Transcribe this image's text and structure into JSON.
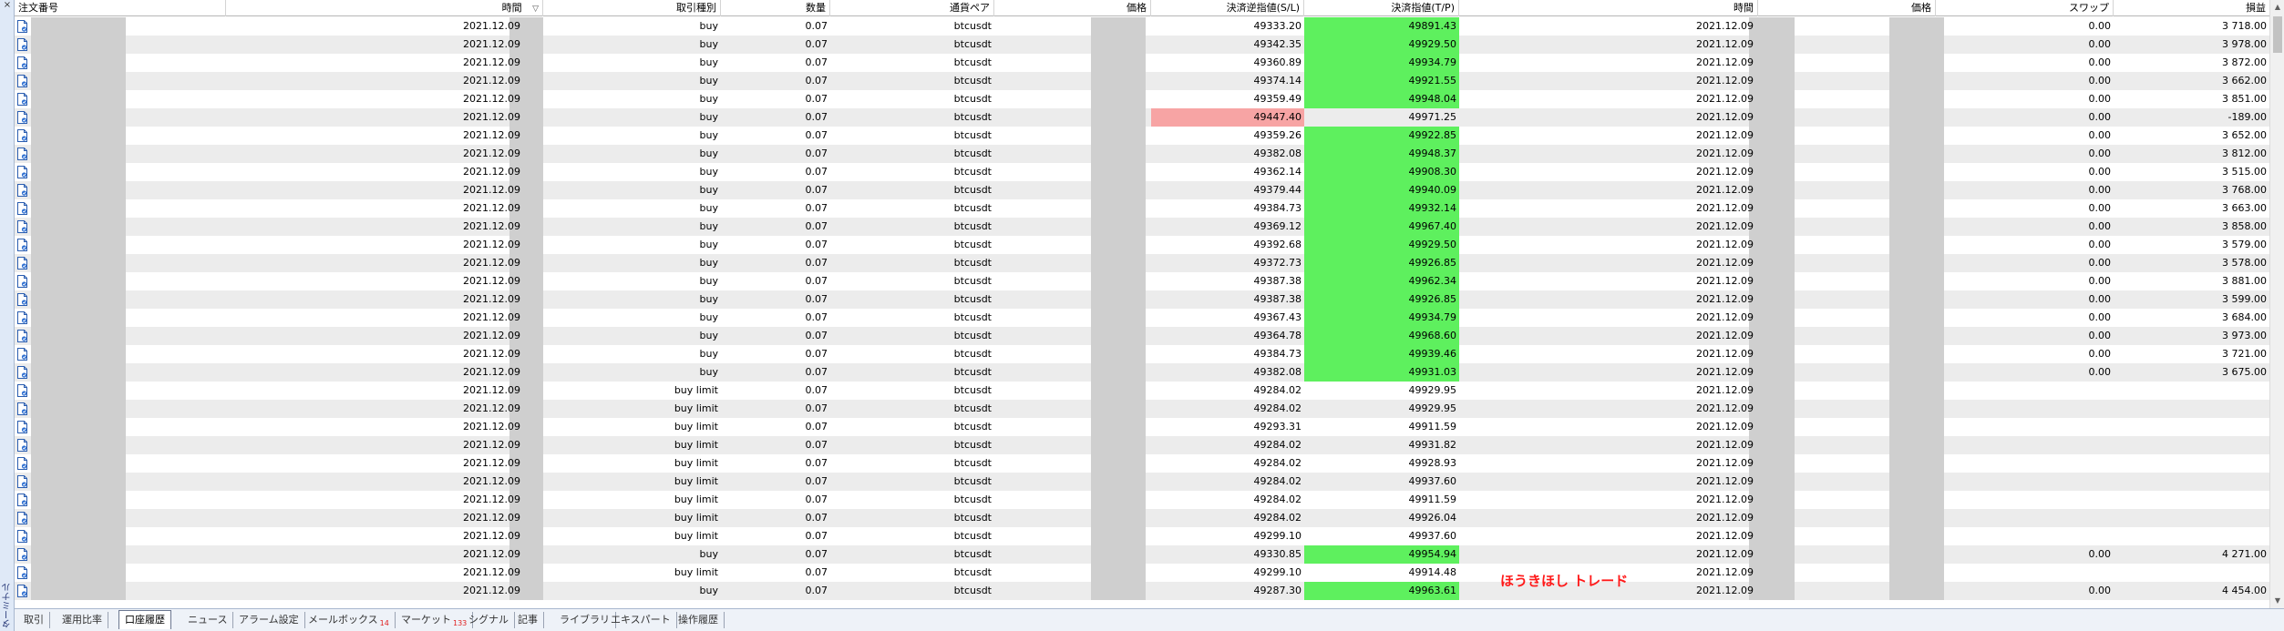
{
  "window": {
    "close_glyph": "×",
    "side_title": "ターミナル"
  },
  "columns": [
    "注文番号",
    "時間",
    "取引種別",
    "数量",
    "通貨ペア",
    "価格",
    "決済逆指値(S/L)",
    "決済指値(T/P)",
    "時間",
    "価格",
    "スワップ",
    "損益"
  ],
  "sort_indicator": "▽",
  "rows": [
    {
      "time": "2021.12.09",
      "type": "buy",
      "qty": "0.07",
      "pair": "btcusdt",
      "sl": "49333.20",
      "tp": "49891.43",
      "close_time": "2021.12.09",
      "swap": "0.00",
      "profit": "3 718.00",
      "sl_hit": false,
      "tp_hit": true
    },
    {
      "time": "2021.12.09",
      "type": "buy",
      "qty": "0.07",
      "pair": "btcusdt",
      "sl": "49342.35",
      "tp": "49929.50",
      "close_time": "2021.12.09",
      "swap": "0.00",
      "profit": "3 978.00",
      "sl_hit": false,
      "tp_hit": true
    },
    {
      "time": "2021.12.09",
      "type": "buy",
      "qty": "0.07",
      "pair": "btcusdt",
      "sl": "49360.89",
      "tp": "49934.79",
      "close_time": "2021.12.09",
      "swap": "0.00",
      "profit": "3 872.00",
      "sl_hit": false,
      "tp_hit": true
    },
    {
      "time": "2021.12.09",
      "type": "buy",
      "qty": "0.07",
      "pair": "btcusdt",
      "sl": "49374.14",
      "tp": "49921.55",
      "close_time": "2021.12.09",
      "swap": "0.00",
      "profit": "3 662.00",
      "sl_hit": false,
      "tp_hit": true
    },
    {
      "time": "2021.12.09",
      "type": "buy",
      "qty": "0.07",
      "pair": "btcusdt",
      "sl": "49359.49",
      "tp": "49948.04",
      "close_time": "2021.12.09",
      "swap": "0.00",
      "profit": "3 851.00",
      "sl_hit": false,
      "tp_hit": true
    },
    {
      "time": "2021.12.09",
      "type": "buy",
      "qty": "0.07",
      "pair": "btcusdt",
      "sl": "49447.40",
      "tp": "49971.25",
      "close_time": "2021.12.09",
      "swap": "0.00",
      "profit": "-189.00",
      "sl_hit": true,
      "tp_hit": false
    },
    {
      "time": "2021.12.09",
      "type": "buy",
      "qty": "0.07",
      "pair": "btcusdt",
      "sl": "49359.26",
      "tp": "49922.85",
      "close_time": "2021.12.09",
      "swap": "0.00",
      "profit": "3 652.00",
      "sl_hit": false,
      "tp_hit": true
    },
    {
      "time": "2021.12.09",
      "type": "buy",
      "qty": "0.07",
      "pair": "btcusdt",
      "sl": "49382.08",
      "tp": "49948.37",
      "close_time": "2021.12.09",
      "swap": "0.00",
      "profit": "3 812.00",
      "sl_hit": false,
      "tp_hit": true
    },
    {
      "time": "2021.12.09",
      "type": "buy",
      "qty": "0.07",
      "pair": "btcusdt",
      "sl": "49362.14",
      "tp": "49908.30",
      "close_time": "2021.12.09",
      "swap": "0.00",
      "profit": "3 515.00",
      "sl_hit": false,
      "tp_hit": true
    },
    {
      "time": "2021.12.09",
      "type": "buy",
      "qty": "0.07",
      "pair": "btcusdt",
      "sl": "49379.44",
      "tp": "49940.09",
      "close_time": "2021.12.09",
      "swap": "0.00",
      "profit": "3 768.00",
      "sl_hit": false,
      "tp_hit": true
    },
    {
      "time": "2021.12.09",
      "type": "buy",
      "qty": "0.07",
      "pair": "btcusdt",
      "sl": "49384.73",
      "tp": "49932.14",
      "close_time": "2021.12.09",
      "swap": "0.00",
      "profit": "3 663.00",
      "sl_hit": false,
      "tp_hit": true
    },
    {
      "time": "2021.12.09",
      "type": "buy",
      "qty": "0.07",
      "pair": "btcusdt",
      "sl": "49369.12",
      "tp": "49967.40",
      "close_time": "2021.12.09",
      "swap": "0.00",
      "profit": "3 858.00",
      "sl_hit": false,
      "tp_hit": true
    },
    {
      "time": "2021.12.09",
      "type": "buy",
      "qty": "0.07",
      "pair": "btcusdt",
      "sl": "49392.68",
      "tp": "49929.50",
      "close_time": "2021.12.09",
      "swap": "0.00",
      "profit": "3 579.00",
      "sl_hit": false,
      "tp_hit": true
    },
    {
      "time": "2021.12.09",
      "type": "buy",
      "qty": "0.07",
      "pair": "btcusdt",
      "sl": "49372.73",
      "tp": "49926.85",
      "close_time": "2021.12.09",
      "swap": "0.00",
      "profit": "3 578.00",
      "sl_hit": false,
      "tp_hit": true
    },
    {
      "time": "2021.12.09",
      "type": "buy",
      "qty": "0.07",
      "pair": "btcusdt",
      "sl": "49387.38",
      "tp": "49962.34",
      "close_time": "2021.12.09",
      "swap": "0.00",
      "profit": "3 881.00",
      "sl_hit": false,
      "tp_hit": true
    },
    {
      "time": "2021.12.09",
      "type": "buy",
      "qty": "0.07",
      "pair": "btcusdt",
      "sl": "49387.38",
      "tp": "49926.85",
      "close_time": "2021.12.09",
      "swap": "0.00",
      "profit": "3 599.00",
      "sl_hit": false,
      "tp_hit": true
    },
    {
      "time": "2021.12.09",
      "type": "buy",
      "qty": "0.07",
      "pair": "btcusdt",
      "sl": "49367.43",
      "tp": "49934.79",
      "close_time": "2021.12.09",
      "swap": "0.00",
      "profit": "3 684.00",
      "sl_hit": false,
      "tp_hit": true
    },
    {
      "time": "2021.12.09",
      "type": "buy",
      "qty": "0.07",
      "pair": "btcusdt",
      "sl": "49364.78",
      "tp": "49968.60",
      "close_time": "2021.12.09",
      "swap": "0.00",
      "profit": "3 973.00",
      "sl_hit": false,
      "tp_hit": true
    },
    {
      "time": "2021.12.09",
      "type": "buy",
      "qty": "0.07",
      "pair": "btcusdt",
      "sl": "49384.73",
      "tp": "49939.46",
      "close_time": "2021.12.09",
      "swap": "0.00",
      "profit": "3 721.00",
      "sl_hit": false,
      "tp_hit": true
    },
    {
      "time": "2021.12.09",
      "type": "buy",
      "qty": "0.07",
      "pair": "btcusdt",
      "sl": "49382.08",
      "tp": "49931.03",
      "close_time": "2021.12.09",
      "swap": "0.00",
      "profit": "3 675.00",
      "sl_hit": false,
      "tp_hit": true
    },
    {
      "time": "2021.12.09",
      "type": "buy limit",
      "qty": "0.07",
      "pair": "btcusdt",
      "sl": "49284.02",
      "tp": "49929.95",
      "close_time": "2021.12.09",
      "swap": "",
      "profit": "",
      "sl_hit": false,
      "tp_hit": false
    },
    {
      "time": "2021.12.09",
      "type": "buy limit",
      "qty": "0.07",
      "pair": "btcusdt",
      "sl": "49284.02",
      "tp": "49929.95",
      "close_time": "2021.12.09",
      "swap": "",
      "profit": "",
      "sl_hit": false,
      "tp_hit": false
    },
    {
      "time": "2021.12.09",
      "type": "buy limit",
      "qty": "0.07",
      "pair": "btcusdt",
      "sl": "49293.31",
      "tp": "49911.59",
      "close_time": "2021.12.09",
      "swap": "",
      "profit": "",
      "sl_hit": false,
      "tp_hit": false
    },
    {
      "time": "2021.12.09",
      "type": "buy limit",
      "qty": "0.07",
      "pair": "btcusdt",
      "sl": "49284.02",
      "tp": "49931.82",
      "close_time": "2021.12.09",
      "swap": "",
      "profit": "",
      "sl_hit": false,
      "tp_hit": false
    },
    {
      "time": "2021.12.09",
      "type": "buy limit",
      "qty": "0.07",
      "pair": "btcusdt",
      "sl": "49284.02",
      "tp": "49928.93",
      "close_time": "2021.12.09",
      "swap": "",
      "profit": "",
      "sl_hit": false,
      "tp_hit": false
    },
    {
      "time": "2021.12.09",
      "type": "buy limit",
      "qty": "0.07",
      "pair": "btcusdt",
      "sl": "49284.02",
      "tp": "49937.60",
      "close_time": "2021.12.09",
      "swap": "",
      "profit": "",
      "sl_hit": false,
      "tp_hit": false
    },
    {
      "time": "2021.12.09",
      "type": "buy limit",
      "qty": "0.07",
      "pair": "btcusdt",
      "sl": "49284.02",
      "tp": "49911.59",
      "close_time": "2021.12.09",
      "swap": "",
      "profit": "",
      "sl_hit": false,
      "tp_hit": false
    },
    {
      "time": "2021.12.09",
      "type": "buy limit",
      "qty": "0.07",
      "pair": "btcusdt",
      "sl": "49284.02",
      "tp": "49926.04",
      "close_time": "2021.12.09",
      "swap": "",
      "profit": "",
      "sl_hit": false,
      "tp_hit": false
    },
    {
      "time": "2021.12.09",
      "type": "buy limit",
      "qty": "0.07",
      "pair": "btcusdt",
      "sl": "49299.10",
      "tp": "49937.60",
      "close_time": "2021.12.09",
      "swap": "",
      "profit": "",
      "sl_hit": false,
      "tp_hit": false
    },
    {
      "time": "2021.12.09",
      "type": "buy",
      "qty": "0.07",
      "pair": "btcusdt",
      "sl": "49330.85",
      "tp": "49954.94",
      "close_time": "2021.12.09",
      "swap": "0.00",
      "profit": "4 271.00",
      "sl_hit": false,
      "tp_hit": true
    },
    {
      "time": "2021.12.09",
      "type": "buy limit",
      "qty": "0.07",
      "pair": "btcusdt",
      "sl": "49299.10",
      "tp": "49914.48",
      "close_time": "2021.12.09",
      "swap": "",
      "profit": "",
      "sl_hit": false,
      "tp_hit": false
    },
    {
      "time": "2021.12.09",
      "type": "buy",
      "qty": "0.07",
      "pair": "btcusdt",
      "sl": "49287.30",
      "tp": "49963.61",
      "close_time": "2021.12.09",
      "swap": "0.00",
      "profit": "4 454.00",
      "sl_hit": false,
      "tp_hit": true
    }
  ],
  "tabs": [
    {
      "label": "取引",
      "badge": "",
      "active": false
    },
    {
      "label": "運用比率",
      "badge": "",
      "active": false
    },
    {
      "label": "口座履歴",
      "badge": "",
      "active": true
    },
    {
      "label": "ニュース",
      "badge": "",
      "active": false
    },
    {
      "label": "アラーム設定",
      "badge": "",
      "active": false
    },
    {
      "label": "メールボックス",
      "badge": "14",
      "active": false
    },
    {
      "label": "マーケット",
      "badge": "133",
      "active": false
    },
    {
      "label": "シグナル",
      "badge": "",
      "active": false
    },
    {
      "label": "記事",
      "badge": "",
      "active": false
    },
    {
      "label": "ライブラリ",
      "badge": "",
      "active": false
    },
    {
      "label": "エキスパート",
      "badge": "",
      "active": false
    },
    {
      "label": "操作履歴",
      "badge": "",
      "active": false
    }
  ],
  "watermark": "ほうきほし トレード",
  "colors": {
    "tp_hit": "#5ef05e",
    "sl_hit": "#f7a4a4",
    "masked": "#cfcfcf",
    "alt_row": "#ececec",
    "watermark": "#ff1a1a"
  },
  "icons": {
    "row": "document-icon"
  }
}
